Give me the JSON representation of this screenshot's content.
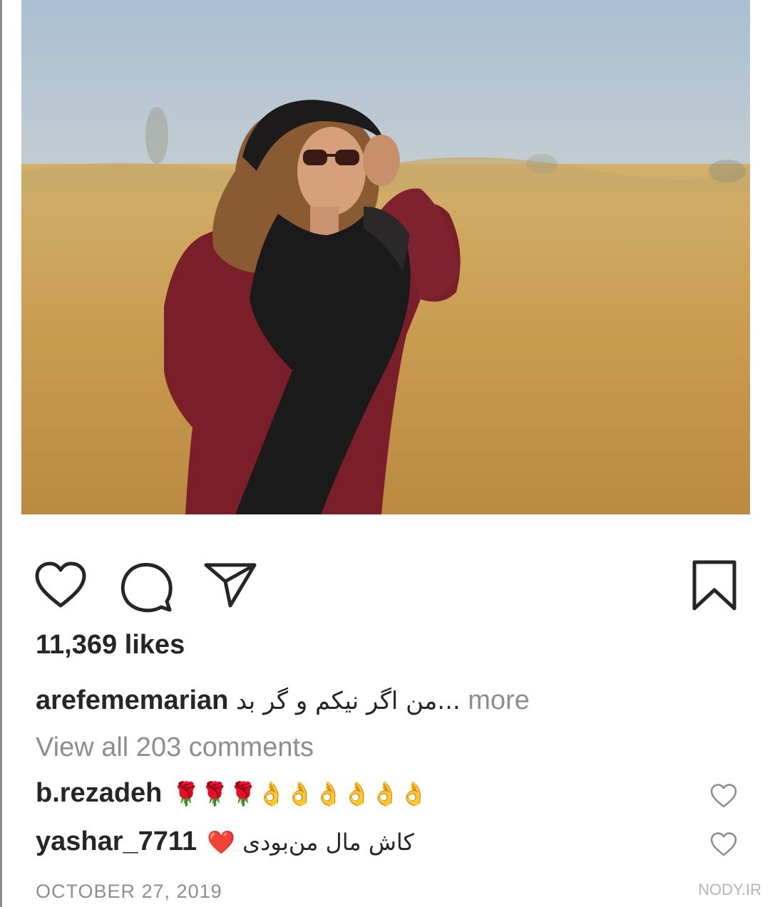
{
  "post": {
    "image_alt": "woman in red coat and black scarf in golden field",
    "likes": "11,369 likes",
    "caption_username": "arefememarian",
    "caption_text": "...من اگر نیکم و گر بد",
    "more_label": "more",
    "view_all_comments": "View all 203 comments",
    "comments": [
      {
        "username": "b.rezadeh",
        "text": "🌹🌹🌹👌👌👌👌👌👌"
      },
      {
        "username": "yashar_7711",
        "text": "کاش مال من‌بودی ❤️"
      }
    ],
    "date": "OCTOBER 27, 2019"
  },
  "actions": {
    "like_icon": "heart-icon",
    "comment_icon": "comment-bubble-icon",
    "share_icon": "paper-plane-icon",
    "save_icon": "bookmark-icon"
  },
  "watermark": "NODY.IR",
  "colors": {
    "text": "#262626",
    "muted": "#8e8e8e"
  }
}
